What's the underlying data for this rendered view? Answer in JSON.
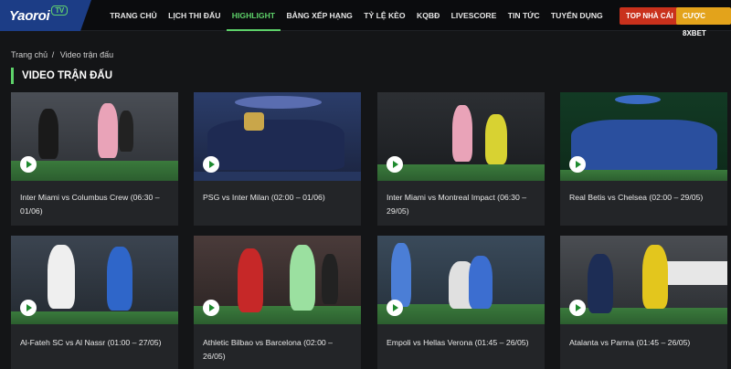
{
  "brand": {
    "name": "Yaoroi",
    "tv": "TV",
    "color": "#1c3d86"
  },
  "nav": [
    {
      "label": "TRANG CHỦ"
    },
    {
      "label": "LỊCH THI ĐẤU"
    },
    {
      "label": "HIGHLIGHT",
      "active": true
    },
    {
      "label": "BẢNG XẾP HẠNG"
    },
    {
      "label": "TỶ LỆ KÈO"
    },
    {
      "label": "KQBĐ"
    },
    {
      "label": "LIVESCORE"
    },
    {
      "label": "TIN TỨC"
    },
    {
      "label": "TUYỂN DỤNG"
    }
  ],
  "buttons": {
    "top_nha_cai": "TOP NHÀ CÁI",
    "cuoc_8xbet": "CƯỢC 8XBET"
  },
  "breadcrumb": {
    "home": "Trang chủ",
    "separator": "/",
    "current": "Video trận đấu"
  },
  "section_title": "VIDEO TRẬN ĐẤU",
  "accent": "#5ed26a",
  "videos": [
    {
      "title": "Inter Miami vs Columbus Crew (06:30 – 01/06)"
    },
    {
      "title": "PSG vs Inter Milan (02:00 – 01/06)"
    },
    {
      "title": "Inter Miami vs Montreal Impact (06:30 – 29/05)"
    },
    {
      "title": "Real Betis vs Chelsea (02:00 – 29/05)"
    },
    {
      "title": "Al-Fateh SC vs Al Nassr (01:00 – 27/05)"
    },
    {
      "title": "Athletic Bilbao vs Barcelona (02:00 – 26/05)"
    },
    {
      "title": "Empoli vs Hellas Verona (01:45 – 26/05)"
    },
    {
      "title": "Atalanta vs Parma (01:45 – 26/05)"
    }
  ]
}
